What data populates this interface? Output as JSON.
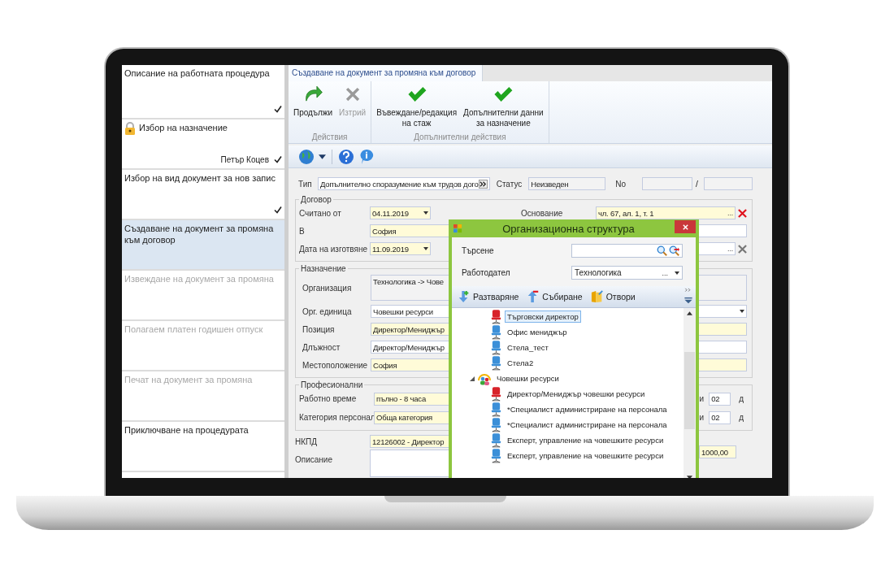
{
  "sidebar": {
    "items": [
      {
        "title": "Описание на работната процедура",
        "locked": false,
        "checked": true,
        "selected": false,
        "disabled": false
      },
      {
        "title": "Избор на назначение",
        "locked": true,
        "assignee": "Петър  Коцев",
        "checked": true,
        "selected": false,
        "disabled": false
      },
      {
        "title": "Избор на вид документ за нов запис",
        "locked": false,
        "checked": true,
        "selected": false,
        "disabled": false
      },
      {
        "title": "Създаване на документ за промяна към договор",
        "locked": false,
        "checked": false,
        "selected": true,
        "disabled": false
      },
      {
        "title": "Извеждане на документ за промяна",
        "locked": false,
        "checked": false,
        "selected": false,
        "disabled": true
      },
      {
        "title": "Полагаем платен годишен отпуск",
        "locked": false,
        "checked": false,
        "selected": false,
        "disabled": true
      },
      {
        "title": "Печат на документ за промяна",
        "locked": false,
        "checked": false,
        "selected": false,
        "disabled": true
      },
      {
        "title": "Приключване на процедурата",
        "locked": false,
        "checked": false,
        "selected": false,
        "disabled": false
      }
    ]
  },
  "tabs": [
    {
      "label": "Създаване на документ за промяна към договор",
      "selected": true
    }
  ],
  "ribbon": {
    "groups": [
      {
        "caption": "Действия",
        "buttons": [
          {
            "label": "Продължи",
            "kind": "continue",
            "disabled": false
          },
          {
            "label": "Изтрий",
            "kind": "delete",
            "disabled": true
          }
        ]
      },
      {
        "caption": "Допълнителни действия",
        "buttons": [
          {
            "label": "Въвеждане/редакция\nна стаж",
            "kind": "confirm",
            "disabled": false
          },
          {
            "label": "Допълнителни данни\nза назначение",
            "kind": "confirm",
            "disabled": false
          }
        ]
      }
    ]
  },
  "form": {
    "type_row": {
      "label": "Тип",
      "value": "Допълнително споразумение към трудов дого",
      "status_label": "Статус",
      "status": "Неизведен",
      "no_label": "No",
      "separator": "/"
    },
    "contract": {
      "legend": "Договор",
      "rows": [
        {
          "label": "Считано от",
          "value": "04.11.2019",
          "kind": "date",
          "required": true,
          "right": {
            "label": "Основание",
            "value": "чл. 67, ал. 1, т. 1",
            "kind": "lookup",
            "ellipsis": "...",
            "clear_enabled": true,
            "required": true
          }
        },
        {
          "label": "В",
          "value": "София",
          "kind": "text",
          "required": true,
          "right": {
            "kind": "text",
            "required": false
          }
        },
        {
          "label": "Дата на изготвяне",
          "value": "11.09.2019",
          "kind": "date",
          "required": true,
          "right": {
            "kind": "lookup",
            "ellipsis": "...",
            "clear_enabled": false,
            "required": false
          }
        }
      ]
    },
    "assignment": {
      "legend": "Назначение",
      "rows": [
        {
          "label": "Организация",
          "value": "Технологика -> Чове",
          "kind": "multiline",
          "required": false
        },
        {
          "label": "Орг. единица",
          "value": "Човешки ресурси",
          "kind": "combo",
          "required": false
        },
        {
          "label": "Позиция",
          "value": "Директор/Мениджър",
          "kind": "text",
          "required": true
        },
        {
          "label": "Длъжност",
          "value": "Директор/Мениджър",
          "kind": "text",
          "required": false
        },
        {
          "label": "Местоположение",
          "value": "София",
          "kind": "text",
          "required": true
        }
      ]
    },
    "professional": {
      "legend": "Професионални",
      "rows": [
        {
          "label": "Работно време",
          "value": "пълно - 8 часа",
          "required": true,
          "prefix": "и",
          "count": "02",
          "unit": "д"
        },
        {
          "label": "Категория персонал",
          "value": "Обща категория",
          "required": true,
          "prefix": "и",
          "count": "02",
          "unit": "д"
        }
      ]
    },
    "extra": {
      "rows": [
        {
          "label": "НКПД",
          "value": "12126002 - Директор",
          "kind": "text",
          "required": true
        },
        {
          "label": "Описание",
          "kind": "multiline",
          "required": false
        }
      ],
      "amount": "1000,00"
    }
  },
  "dialog": {
    "title": "Организационна структура",
    "search": {
      "label": "Търсене"
    },
    "employer": {
      "label": "Работодател",
      "value": "Технологика",
      "ellipsis": "..."
    },
    "toolbar": [
      {
        "label": "Разтваряне",
        "kind": "expand"
      },
      {
        "label": "Събиране",
        "kind": "collapse"
      },
      {
        "label": "Отвори",
        "kind": "open"
      }
    ],
    "tree": [
      {
        "children": [
          {
            "label": "Търговски директор",
            "kind": "head",
            "selected": true
          },
          {
            "label": "Офис мениджър",
            "kind": "position",
            "selected": false
          },
          {
            "label": "Стела_тест",
            "kind": "position",
            "selected": false
          },
          {
            "label": "Стела2",
            "kind": "position",
            "selected": false
          }
        ]
      },
      {
        "label": "Човешки ресурси",
        "kind": "unit",
        "expanded": true,
        "selected": false,
        "children": [
          {
            "label": "Директор/Мениджър човешки ресурси",
            "kind": "head",
            "selected": false
          },
          {
            "label": "*Специалист администриране на персонала",
            "kind": "position",
            "selected": false
          },
          {
            "label": "*Специалист администриране на персонала",
            "kind": "position",
            "selected": false
          },
          {
            "label": "Експерт, управление на човешките ресурси",
            "kind": "position",
            "selected": false
          },
          {
            "label": "Експерт, управление на човешките ресурси",
            "kind": "position",
            "selected": false
          }
        ]
      }
    ]
  }
}
